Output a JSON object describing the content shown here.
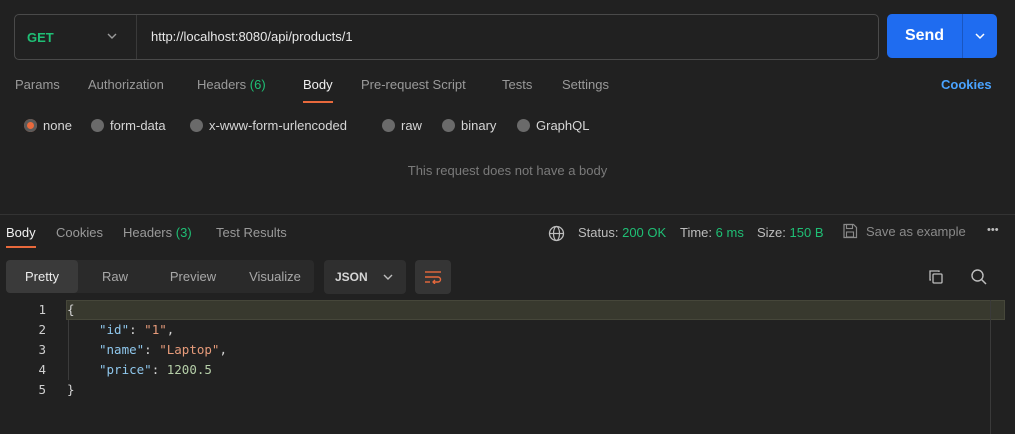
{
  "request": {
    "method": "GET",
    "url": "http://localhost:8080/api/products/1",
    "send_label": "Send"
  },
  "request_tabs": {
    "params": "Params",
    "authorization": "Authorization",
    "headers": "Headers",
    "headers_count": "(6)",
    "body": "Body",
    "prerequest": "Pre-request Script",
    "tests": "Tests",
    "settings": "Settings",
    "cookies": "Cookies"
  },
  "body_types": {
    "none": "none",
    "form_data": "form-data",
    "urlencoded": "x-www-form-urlencoded",
    "raw": "raw",
    "binary": "binary",
    "graphql": "GraphQL"
  },
  "no_body_message": "This request does not have a body",
  "response_tabs": {
    "body": "Body",
    "cookies": "Cookies",
    "headers": "Headers",
    "headers_count": "(3)",
    "test_results": "Test Results"
  },
  "response_meta": {
    "status_label": "Status:",
    "status_value": "200 OK",
    "time_label": "Time:",
    "time_value": "6 ms",
    "size_label": "Size:",
    "size_value": "150 B",
    "save_example": "Save as example",
    "more": "•••"
  },
  "view_modes": {
    "pretty": "Pretty",
    "raw": "Raw",
    "preview": "Preview",
    "visualize": "Visualize"
  },
  "format": "JSON",
  "code": {
    "line_numbers": [
      "1",
      "2",
      "3",
      "4",
      "5"
    ],
    "open_brace": "{",
    "close_brace": "}",
    "id_key": "\"id\"",
    "id_value": "\"1\"",
    "name_key": "\"name\"",
    "name_value": "\"Laptop\"",
    "price_key": "\"price\"",
    "price_value": "1200.5",
    "colon": ": ",
    "comma": ","
  },
  "colors": {
    "accent": "#e8693c",
    "send": "#1f6cf0",
    "method": "#1fbf75",
    "status": "#1fbf75",
    "link": "#4aa3ff"
  }
}
